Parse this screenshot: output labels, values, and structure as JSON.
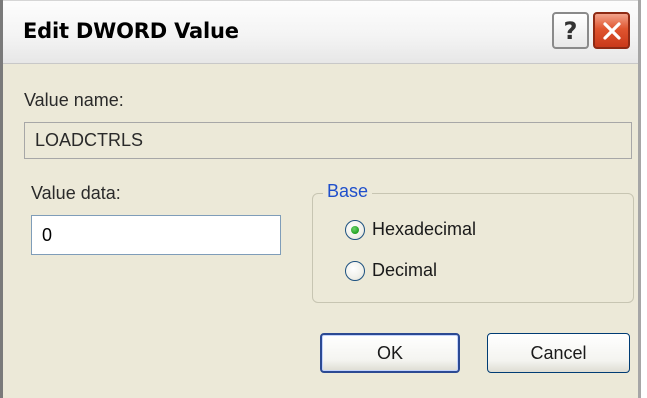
{
  "dialog": {
    "title": "Edit DWORD Value",
    "help_icon": "help-question-icon",
    "close_icon": "close-x-icon"
  },
  "value_name": {
    "label": "Value name:",
    "value": "LOADCTRLS"
  },
  "value_data": {
    "label": "Value data:",
    "value": "0"
  },
  "base": {
    "legend": "Base",
    "options": [
      {
        "label": "Hexadecimal",
        "selected": true
      },
      {
        "label": "Decimal",
        "selected": false
      }
    ]
  },
  "buttons": {
    "ok_label": "OK",
    "cancel_label": "Cancel"
  },
  "colors": {
    "dialog_background": "#ECE9D8",
    "legend_blue": "#1F4FCB",
    "close_red": "#E0552F",
    "radio_green": "#21A121"
  }
}
